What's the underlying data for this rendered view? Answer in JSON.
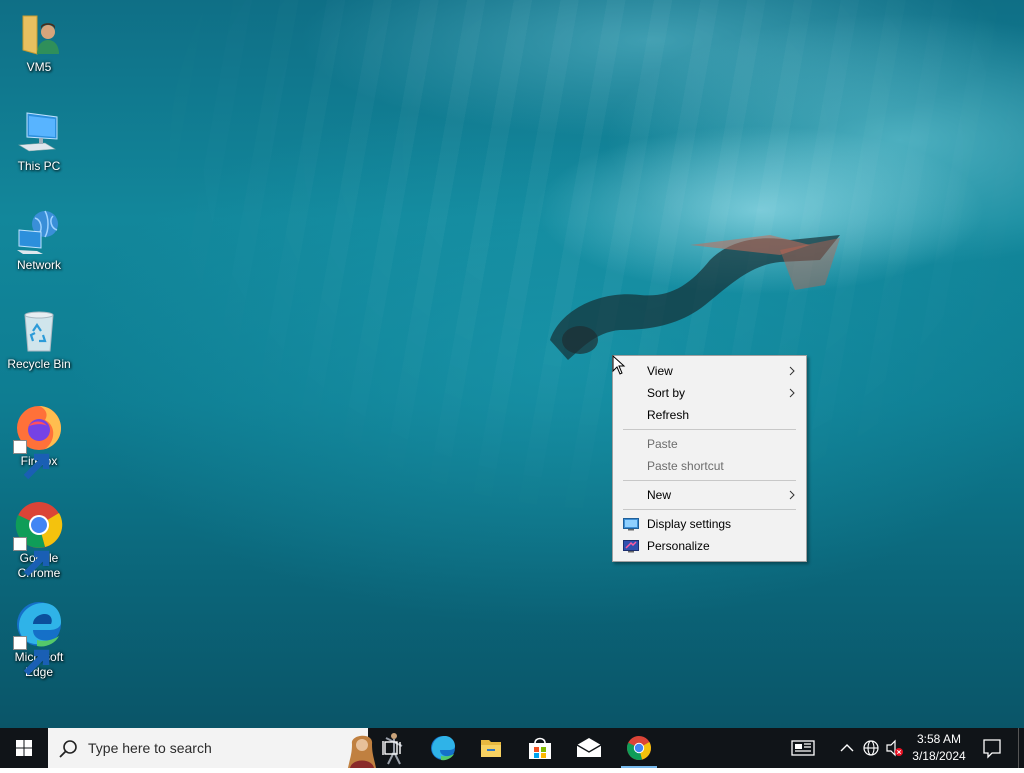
{
  "desktop_icons": [
    {
      "label": "VM5",
      "icon": "user-folder-icon"
    },
    {
      "label": "This PC",
      "icon": "computer-icon"
    },
    {
      "label": "Network",
      "icon": "network-icon"
    },
    {
      "label": "Recycle Bin",
      "icon": "recycle-bin-icon"
    },
    {
      "label": "Firefox",
      "icon": "firefox-icon"
    },
    {
      "label": "Google Chrome",
      "icon": "chrome-icon"
    },
    {
      "label": "Microsoft Edge",
      "icon": "edge-icon"
    }
  ],
  "context_menu": {
    "items": [
      {
        "label": "View",
        "submenu": true,
        "enabled": true
      },
      {
        "label": "Sort by",
        "submenu": true,
        "enabled": true
      },
      {
        "label": "Refresh",
        "submenu": false,
        "enabled": true
      },
      {
        "label": "Paste",
        "submenu": false,
        "enabled": false
      },
      {
        "label": "Paste shortcut",
        "submenu": false,
        "enabled": false
      },
      {
        "label": "New",
        "submenu": true,
        "enabled": true
      },
      {
        "label": "Display settings",
        "submenu": false,
        "enabled": true,
        "icon": "display-settings-icon"
      },
      {
        "label": "Personalize",
        "submenu": false,
        "enabled": true,
        "icon": "personalize-icon"
      }
    ]
  },
  "taskbar": {
    "search_placeholder": "Type here to search",
    "pinned_apps": [
      "task-view-icon",
      "edge-icon",
      "file-explorer-icon",
      "store-icon",
      "mail-icon",
      "chrome-icon"
    ],
    "tray": {
      "time": "3:58 AM",
      "date": "3/18/2024",
      "icons": [
        "news-icon",
        "chevron-up-icon",
        "network-globe-icon",
        "volume-muted-icon",
        "notifications-icon"
      ]
    }
  },
  "colors": {
    "taskbar_bg": "#101418",
    "menu_bg": "#f2f2f2",
    "disabled_text": "#6d6d6d",
    "accent": "#0078d7"
  }
}
